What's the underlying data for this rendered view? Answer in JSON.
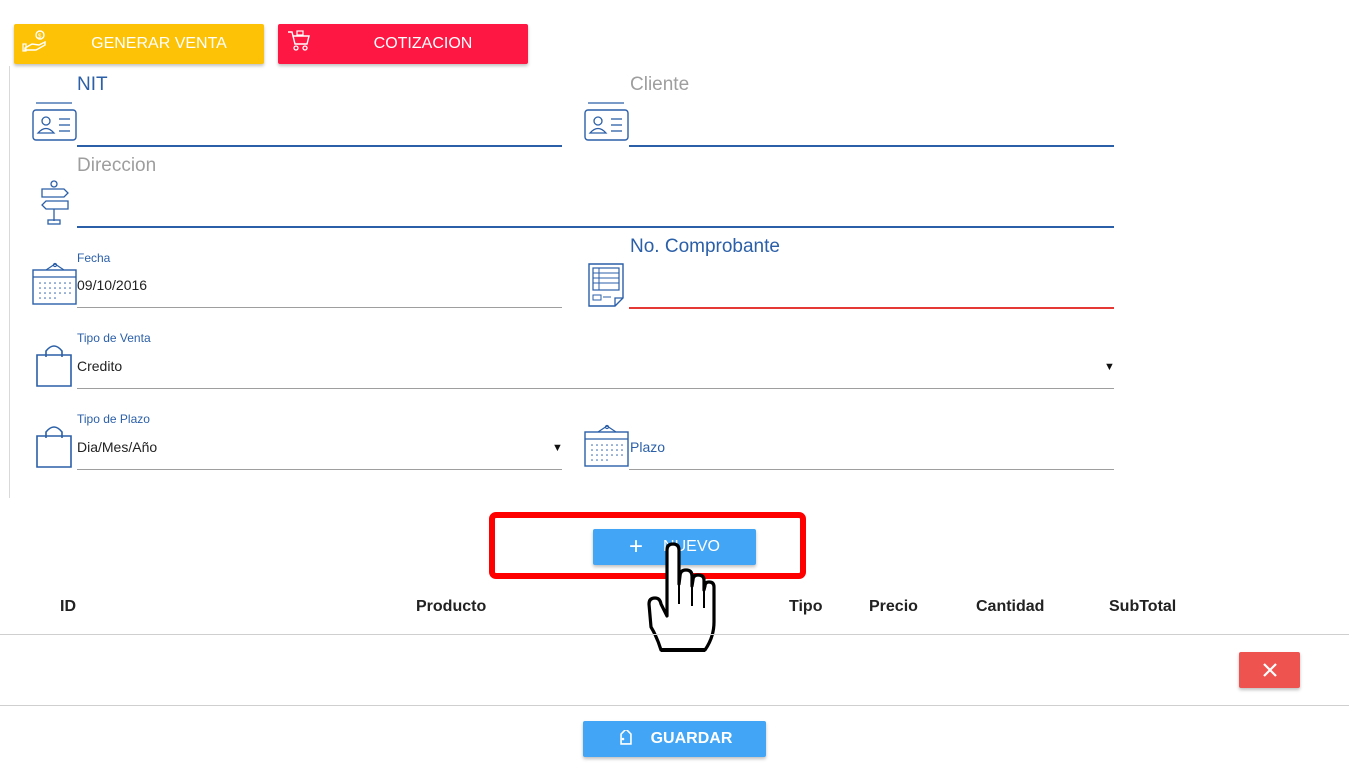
{
  "toolbar": {
    "generar_label": "GENERAR VENTA",
    "cotizacion_label": "COTIZACION",
    "generar_color": "#fdc206",
    "cotizacion_color": "#ff1744"
  },
  "form": {
    "nit_label": "NIT",
    "nit_value": "",
    "cliente_label": "Cliente",
    "cliente_value": "",
    "direccion_label": "Direccion",
    "direccion_value": "",
    "fecha_label": "Fecha",
    "fecha_value": "09/10/2016",
    "comprobante_label": "No. Comprobante",
    "comprobante_value": "",
    "tipo_venta_label": "Tipo de Venta",
    "tipo_venta_value": "Credito",
    "tipo_plazo_label": "Tipo de Plazo",
    "tipo_plazo_value": "Dia/Mes/Año",
    "plazo_label": "Plazo",
    "plazo_value": ""
  },
  "actions": {
    "nuevo_label": "NUEVO",
    "guardar_label": "GUARDAR",
    "highlight_color": "#ff0000"
  },
  "table": {
    "columns": [
      "ID",
      "Producto",
      "Tipo",
      "Precio",
      "Cantidad",
      "SubTotal"
    ],
    "rows": []
  },
  "icons": {
    "nit": "id-card-icon",
    "cliente": "id-card-icon",
    "direccion": "signpost-icon",
    "fecha": "calendar-icon",
    "comprobante": "receipt-icon",
    "tipo_venta": "shopping-bag-icon",
    "tipo_plazo": "shopping-bag-icon",
    "plazo": "calendar-icon",
    "delete_row": "close-icon"
  }
}
